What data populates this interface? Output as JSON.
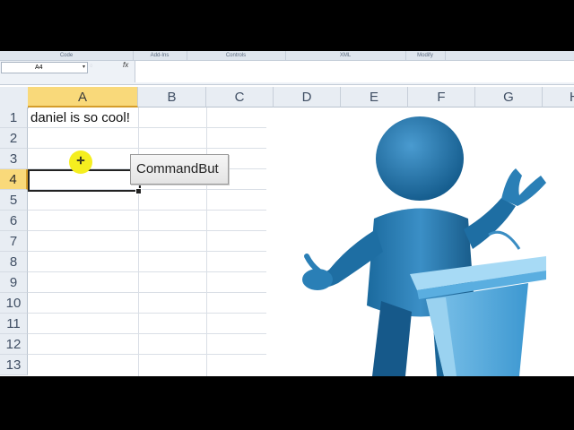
{
  "ribbon": {
    "groups": [
      "Code",
      "Add-Ins",
      "Controls",
      "XML",
      "Modify"
    ]
  },
  "formula_bar": {
    "name_box_value": "A4",
    "fx_label": "fx",
    "formula_value": ""
  },
  "grid": {
    "columns": [
      "A",
      "B",
      "C",
      "D",
      "E",
      "F",
      "G",
      "H"
    ],
    "rows": [
      "1",
      "2",
      "3",
      "4",
      "5",
      "6",
      "7",
      "8",
      "9",
      "10",
      "11",
      "12",
      "13"
    ],
    "active_column": "A",
    "active_row": "4",
    "cells": {
      "A1": "daniel is so cool!"
    }
  },
  "command_button": {
    "label": "CommandBut"
  },
  "picture": {
    "description_icon": "presenter-at-podium-icon",
    "figure_color": "#1f6fa3",
    "podium_color": "#5aaee0"
  },
  "colors": {
    "header_bg": "#e8edf3",
    "active_header": "#f9d97a",
    "cursor_highlight": "#f5ee1f"
  }
}
